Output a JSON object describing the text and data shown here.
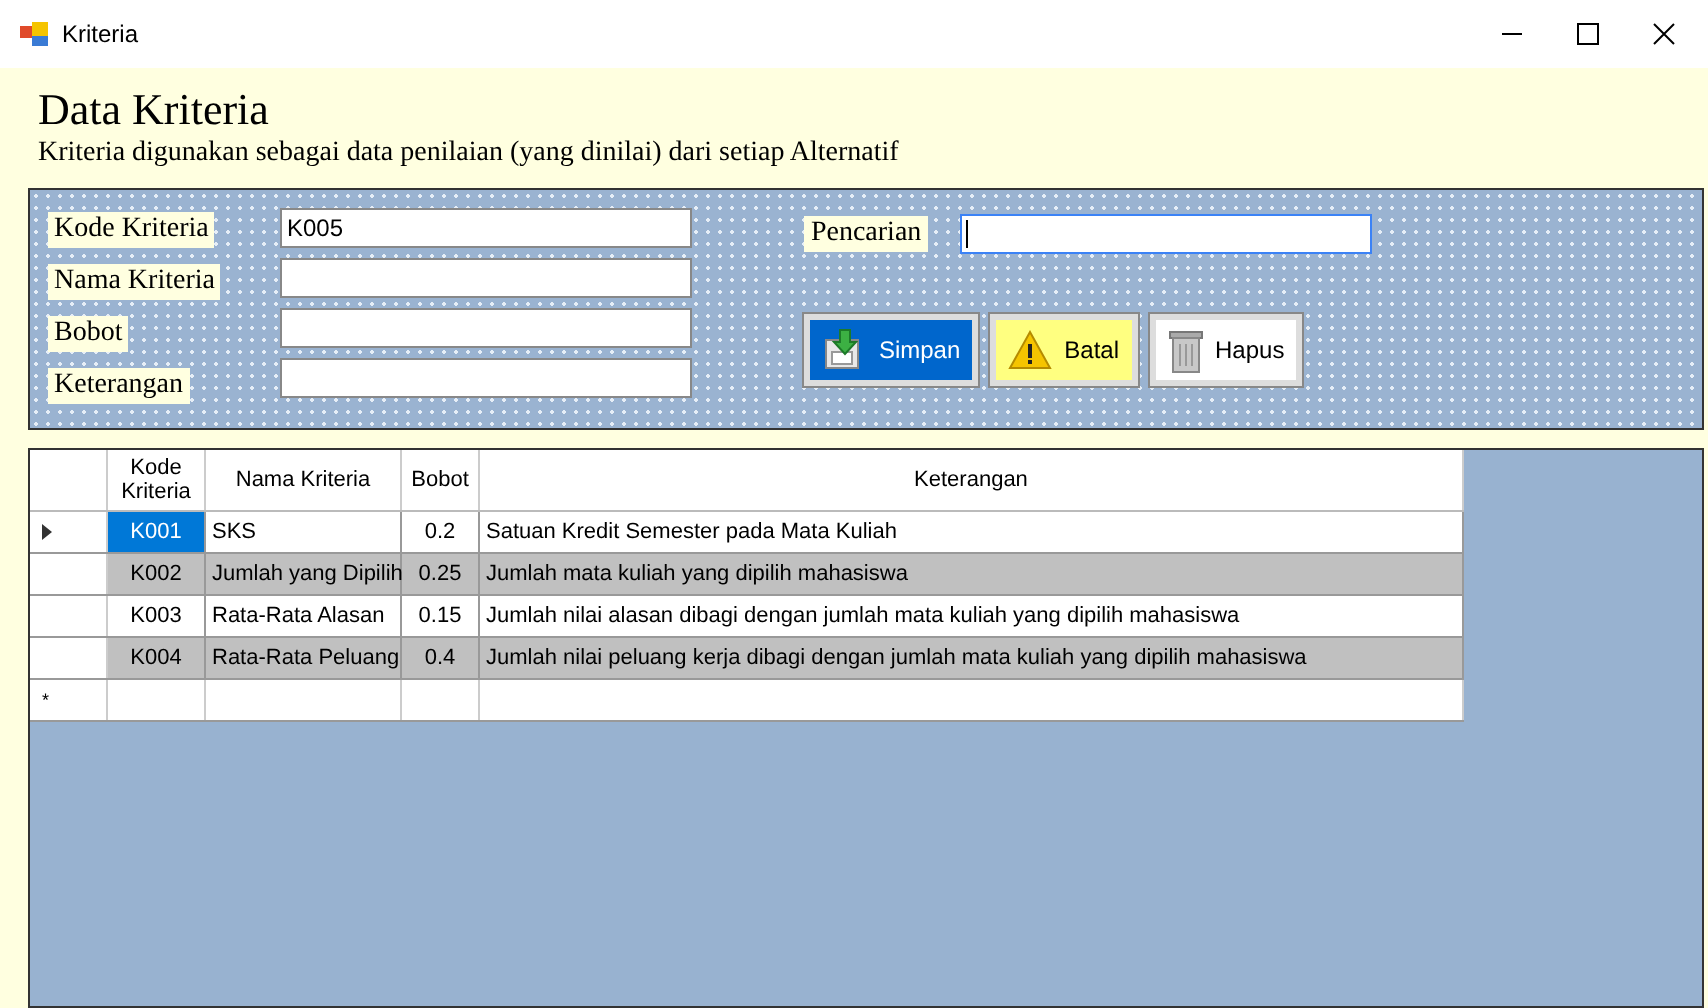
{
  "window": {
    "title": "Kriteria"
  },
  "header": {
    "title": "Data Kriteria",
    "subtitle": "Kriteria digunakan sebagai data penilaian (yang dinilai) dari setiap Alternatif"
  },
  "form": {
    "fields": [
      {
        "label": "Kode Kriteria",
        "value": "K005"
      },
      {
        "label": "Nama Kriteria"
      },
      {
        "label": "Bobot"
      },
      {
        "label": "Keterangan"
      }
    ],
    "search": {
      "label": "Pencarian",
      "focused": true
    },
    "buttons": [
      {
        "label": "Simpan",
        "kind": "save"
      },
      {
        "label": "Batal",
        "kind": "cancel"
      },
      {
        "label": "Hapus",
        "kind": "delete"
      }
    ]
  },
  "table": {
    "columns": [
      "Kode Kriteria",
      "Nama Kriteria",
      "Bobot",
      "Keterangan"
    ],
    "rows": [
      {
        "cells": [
          "K001",
          "SKS",
          "0.2",
          "Satuan Kredit Semester pada  Mata Kuliah"
        ],
        "selected": true
      },
      {
        "cells": [
          "K002",
          "Jumlah yang Dipilih",
          "0.25",
          "Jumlah mata kuliah yang dipilih mahasiswa"
        ],
        "selected": false
      },
      {
        "cells": [
          "K003",
          "Rata-Rata Alasan",
          "0.15",
          "Jumlah nilai alasan dibagi dengan jumlah mata kuliah yang dipilih mahasiswa"
        ],
        "selected": false
      },
      {
        "cells": [
          "K004",
          "Rata-Rata Peluang",
          "0.4",
          "Jumlah nilai peluang kerja dibagi dengan jumlah mata kuliah yang dipilih mahasiswa"
        ],
        "selected": false
      }
    ],
    "new_row_marker": "*"
  }
}
